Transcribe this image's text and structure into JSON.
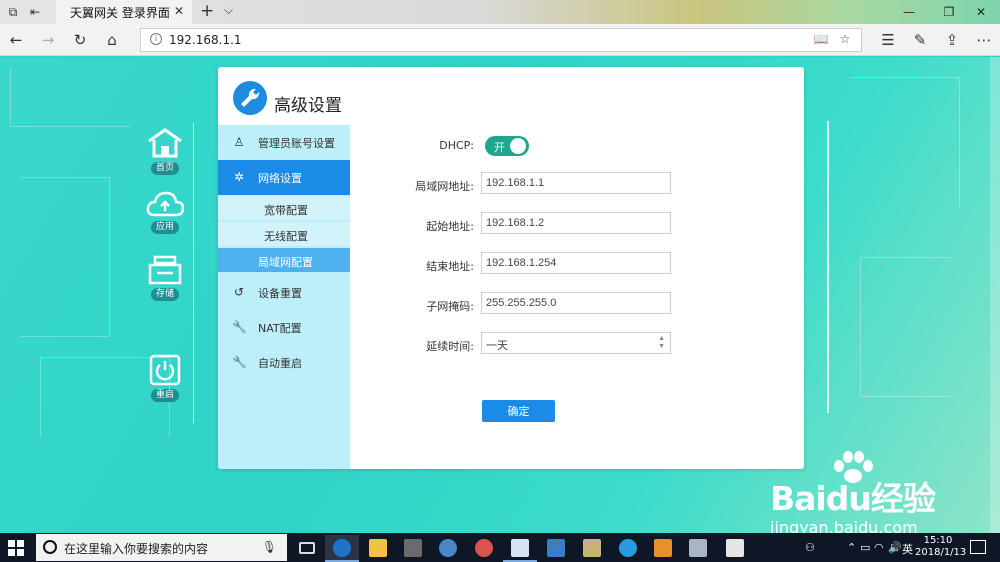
{
  "browser": {
    "tab_title": "天翼网关 登录界面",
    "url": "192.168.1.1"
  },
  "side_nav": [
    {
      "label": "首页",
      "icon": "home-icon"
    },
    {
      "label": "应用",
      "icon": "cloud-icon"
    },
    {
      "label": "存储",
      "icon": "storage-icon"
    },
    {
      "label": "重启",
      "icon": "power-icon"
    }
  ],
  "panel": {
    "title": "高级设置",
    "menu": [
      {
        "label": "管理员账号设置",
        "icon": "user-icon"
      },
      {
        "label": "网络设置",
        "icon": "gear-icon"
      },
      {
        "label": "设备重置",
        "icon": "reset-icon"
      },
      {
        "label": "NAT配置",
        "icon": "wrench-icon"
      },
      {
        "label": "自动重启",
        "icon": "wrench-icon"
      }
    ],
    "submenu": [
      {
        "label": "宽带配置"
      },
      {
        "label": "无线配置"
      },
      {
        "label": "局域网配置"
      }
    ]
  },
  "form": {
    "dhcp_label": "DHCP:",
    "dhcp_state": "开",
    "lan_ip_label": "局域网地址:",
    "lan_ip": "192.168.1.1",
    "start_label": "起始地址:",
    "start_ip": "192.168.1.2",
    "end_label": "结束地址:",
    "end_ip": "192.168.1.254",
    "mask_label": "子网掩码:",
    "mask": "255.255.255.0",
    "lease_label": "延续时间:",
    "lease": "一天",
    "confirm_label": "确定"
  },
  "watermark": {
    "logo": "Baidu经验",
    "url": "jingyan.baidu.com"
  },
  "taskbar": {
    "search_placeholder": "在这里输入你要搜索的内容",
    "ime": "英",
    "time": "15:10",
    "date": "2018/1/13"
  },
  "colors": {
    "accent": "#1a8be6",
    "menu_bg": "#bdeffa",
    "toggle_on": "#1fa68c",
    "page_bg": "#2fd0c8"
  }
}
